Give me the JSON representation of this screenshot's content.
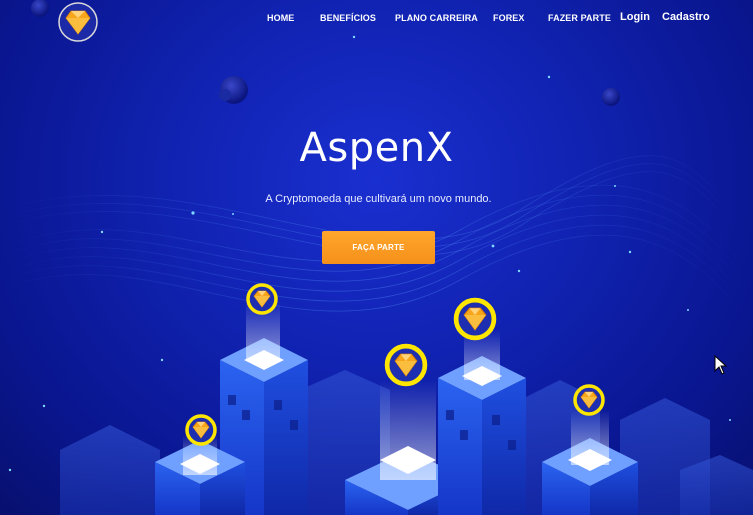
{
  "nav": {
    "items": [
      {
        "label": "HOME"
      },
      {
        "label": "BENEFÍCIOS"
      },
      {
        "label": "PLANO CARREIRA"
      },
      {
        "label": "FOREX"
      },
      {
        "label": "FAZER PARTE"
      }
    ],
    "login": "Login",
    "signup": "Cadastro"
  },
  "hero": {
    "title": "AspenX",
    "subtitle": "A Cryptomoeda que cultivará um novo mundo.",
    "cta": "FAÇA PARTE"
  },
  "colors": {
    "background": "#1022b0",
    "accent": "#f5901a",
    "coin_ring": "#ffe600",
    "gem": "#f7a61b"
  },
  "icons": {
    "logo": "diamond-gem-logo",
    "coin": "diamond-coin",
    "cursor": "mouse-pointer"
  }
}
